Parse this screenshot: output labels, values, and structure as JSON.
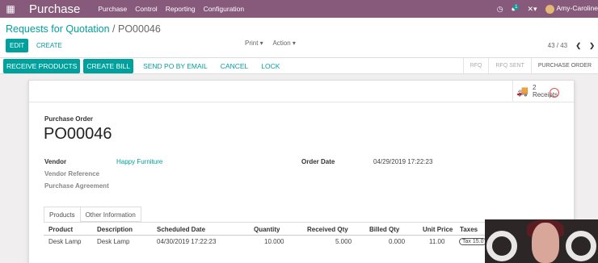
{
  "topbar": {
    "app_name": "Purchase",
    "menu": [
      "Purchase",
      "Control",
      "Reporting",
      "Configuration"
    ],
    "message_count": "1",
    "user_name": "Amy-Caroline"
  },
  "breadcrumb": {
    "parent": "Requests for Quotation",
    "separator": "/",
    "current": "PO00046"
  },
  "control": {
    "edit_label": "EDIT",
    "create_label": "CREATE",
    "print_label": "Print ▾",
    "action_label": "Action ▾",
    "pager": "43 / 43"
  },
  "statusbar": {
    "receive_products": "RECEIVE PRODUCTS",
    "create_bill": "CREATE BILL",
    "send_po": "SEND PO BY EMAIL",
    "cancel": "CANCEL",
    "lock": "LOCK",
    "stages": [
      "RFQ",
      "RFQ SENT",
      "PURCHASE ORDER"
    ],
    "active_stage": "PURCHASE ORDER"
  },
  "smart_button": {
    "count": "2",
    "label": "Receipts"
  },
  "form": {
    "doc_label": "Purchase Order",
    "doc_name": "PO00046",
    "vendor_label": "Vendor",
    "vendor_value": "Happy Furniture",
    "vendor_ref_label": "Vendor Reference",
    "agreement_label": "Purchase Agreement",
    "order_date_label": "Order Date",
    "order_date_value": "04/29/2019 17:22:23"
  },
  "tabs": [
    "Products",
    "Other Information"
  ],
  "table": {
    "headers": [
      "Product",
      "Description",
      "Scheduled Date",
      "Quantity",
      "Received Qty",
      "Billed Qty",
      "Unit Price",
      "Taxes"
    ],
    "rows": [
      {
        "product": "Desk Lamp",
        "description": "Desk Lamp",
        "scheduled_date": "04/30/2019 17:22:23",
        "quantity": "10.000",
        "received_qty": "5.000",
        "billed_qty": "0.000",
        "unit_price": "11.00",
        "taxes": "Tax 15.0"
      }
    ]
  },
  "colors": {
    "nav": "#875a7b",
    "accent": "#00a09d"
  }
}
